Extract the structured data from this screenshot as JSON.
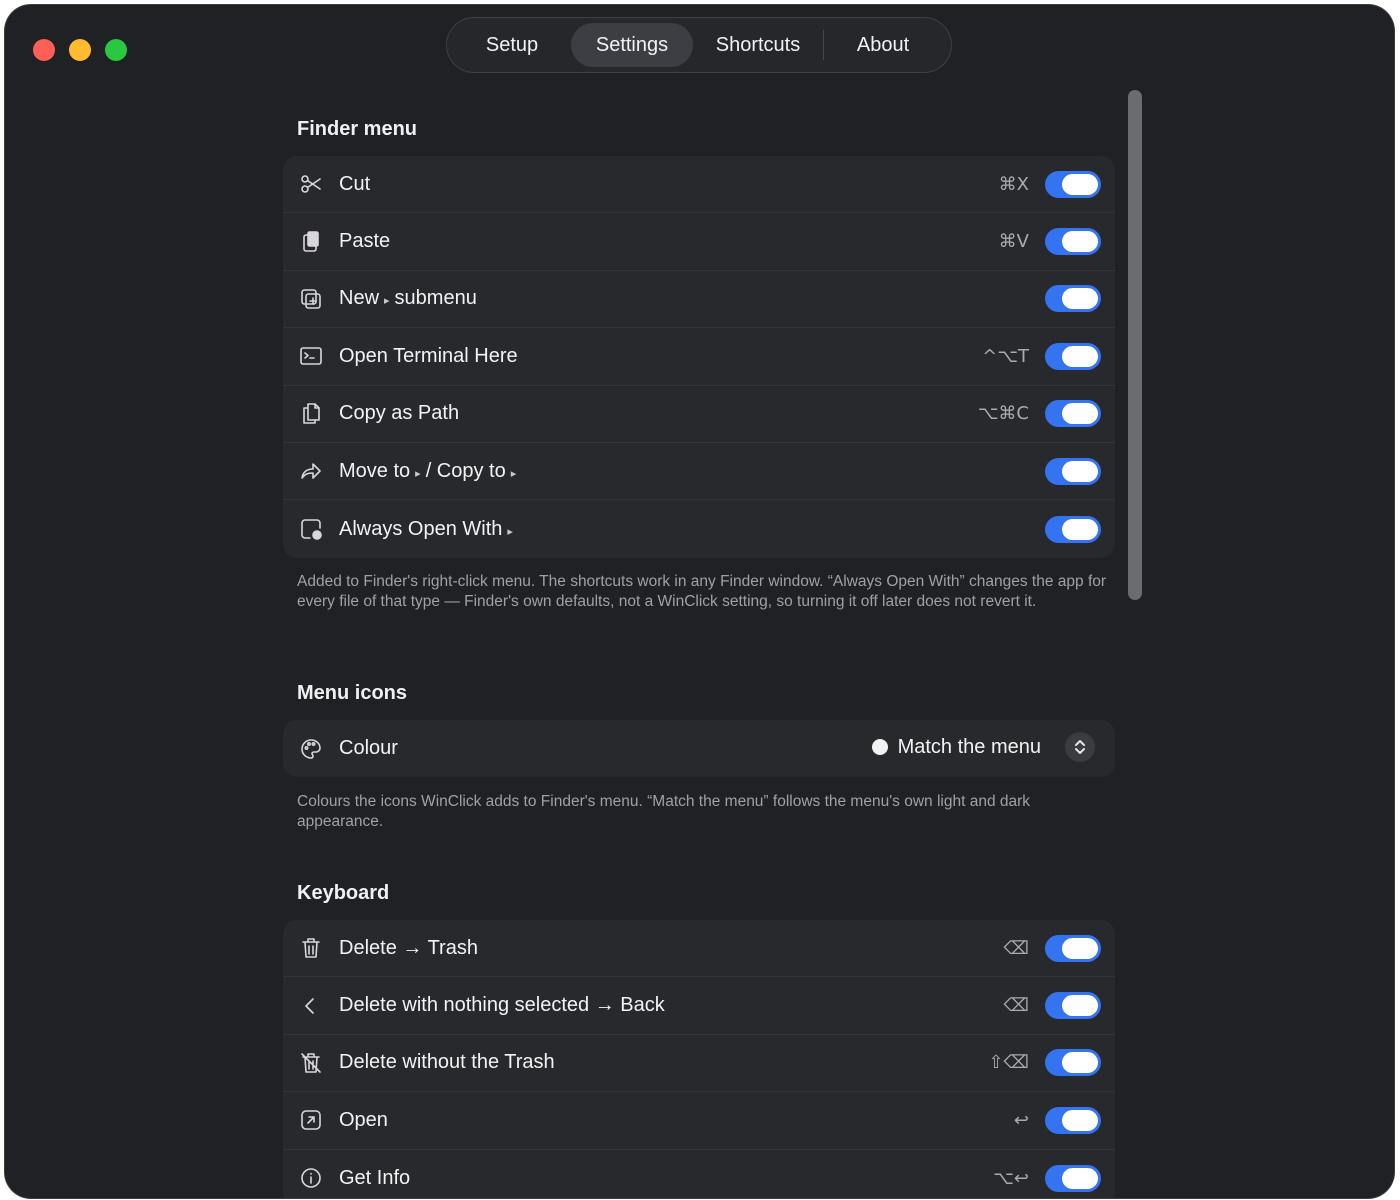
{
  "tabs": [
    {
      "label": "Setup",
      "active": false
    },
    {
      "label": "Settings",
      "active": true
    },
    {
      "label": "Shortcuts",
      "active": false
    },
    {
      "label": "About",
      "active": false
    }
  ],
  "finder_menu": {
    "title": "Finder menu",
    "items": [
      {
        "icon": "scissors-icon",
        "label": "Cut",
        "shortcut": "⌘X",
        "enabled": true
      },
      {
        "icon": "clipboard-icon",
        "label": "Paste",
        "shortcut": "⌘V",
        "enabled": true
      },
      {
        "icon": "new-item-icon",
        "label": "New",
        "arrow": "▸",
        "suffix": "submenu",
        "shortcut": "",
        "enabled": true
      },
      {
        "icon": "terminal-icon",
        "label": "Open Terminal Here",
        "shortcut": "^⌥T",
        "enabled": true
      },
      {
        "icon": "copy-path-icon",
        "label": "Copy as Path",
        "shortcut": "⌥⌘C",
        "enabled": true
      },
      {
        "icon": "move-arrow-icon",
        "label": "Move to",
        "arrow": "▸",
        "suffix": "/ Copy to",
        "arrow2": "▸",
        "shortcut": "",
        "enabled": true
      },
      {
        "icon": "open-with-icon",
        "label": "Always Open With",
        "arrow": "▸",
        "shortcut": "",
        "enabled": true
      }
    ],
    "note": "Added to Finder's right-click menu. The shortcuts work in any Finder window. “Always Open With” changes the app for every file of that type — Finder's own defaults, not a WinClick setting, so turning it off later does not revert it."
  },
  "menu_icons": {
    "title": "Menu icons",
    "colour_label": "Colour",
    "colour_value": "Match the menu",
    "note": "Colours the icons WinClick adds to Finder's menu. “Match the menu” follows the menu's own light and dark appearance."
  },
  "keyboard": {
    "title": "Keyboard",
    "items": [
      {
        "icon": "trash-icon",
        "label": "Delete → Trash",
        "shortcut": "⌫",
        "enabled": true
      },
      {
        "icon": "chevron-left-icon",
        "label": "Delete with nothing selected → Back",
        "shortcut": "⌫",
        "enabled": true
      },
      {
        "icon": "trash-slash-icon",
        "label": "Delete without the Trash",
        "shortcut": "⇧⌫",
        "enabled": true
      },
      {
        "icon": "open-arrow-icon",
        "label": "Open",
        "shortcut": "↩",
        "enabled": true
      },
      {
        "icon": "info-icon",
        "label": "Get Info",
        "shortcut": "⌥↩",
        "enabled": true
      }
    ]
  },
  "colors": {
    "toggle_on": "#3574f0",
    "window_bg": "#1f2125",
    "card_bg": "#28292d"
  }
}
